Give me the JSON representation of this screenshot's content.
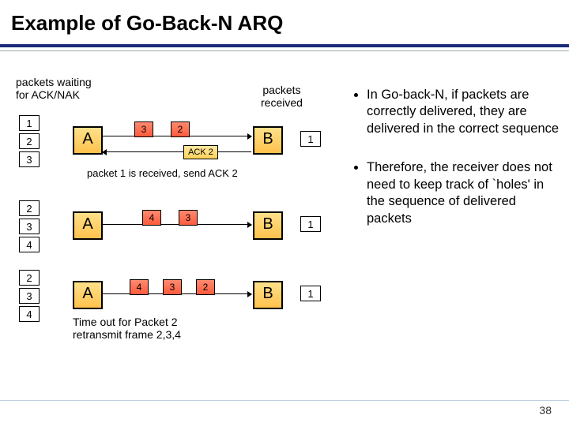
{
  "title": "Example of Go-Back-N ARQ",
  "page": "38",
  "bullets": [
    "In Go-back-N, if packets are correctly delivered, they are delivered in the correct sequence",
    "Therefore, the receiver does not need to keep track of `holes' in the sequence of delivered packets"
  ],
  "labels": {
    "waiting": "packets waiting\nfor ACK/NAK",
    "received": "packets\nreceived",
    "row1_caption": "packet 1 is received, send ACK 2",
    "row3_caption": "Time out for Packet 2\nretransmit frame 2,3,4",
    "ack2": "ACK 2",
    "A": "A",
    "B": "B",
    "q1": [
      "1",
      "2",
      "3"
    ],
    "q2": [
      "2",
      "3",
      "4"
    ],
    "q3": [
      "2",
      "3",
      "4"
    ],
    "deliv": "1",
    "transit1": [
      "3",
      "2"
    ],
    "transit2": [
      "4",
      "3"
    ],
    "transit3": [
      "4",
      "3",
      "2"
    ]
  }
}
